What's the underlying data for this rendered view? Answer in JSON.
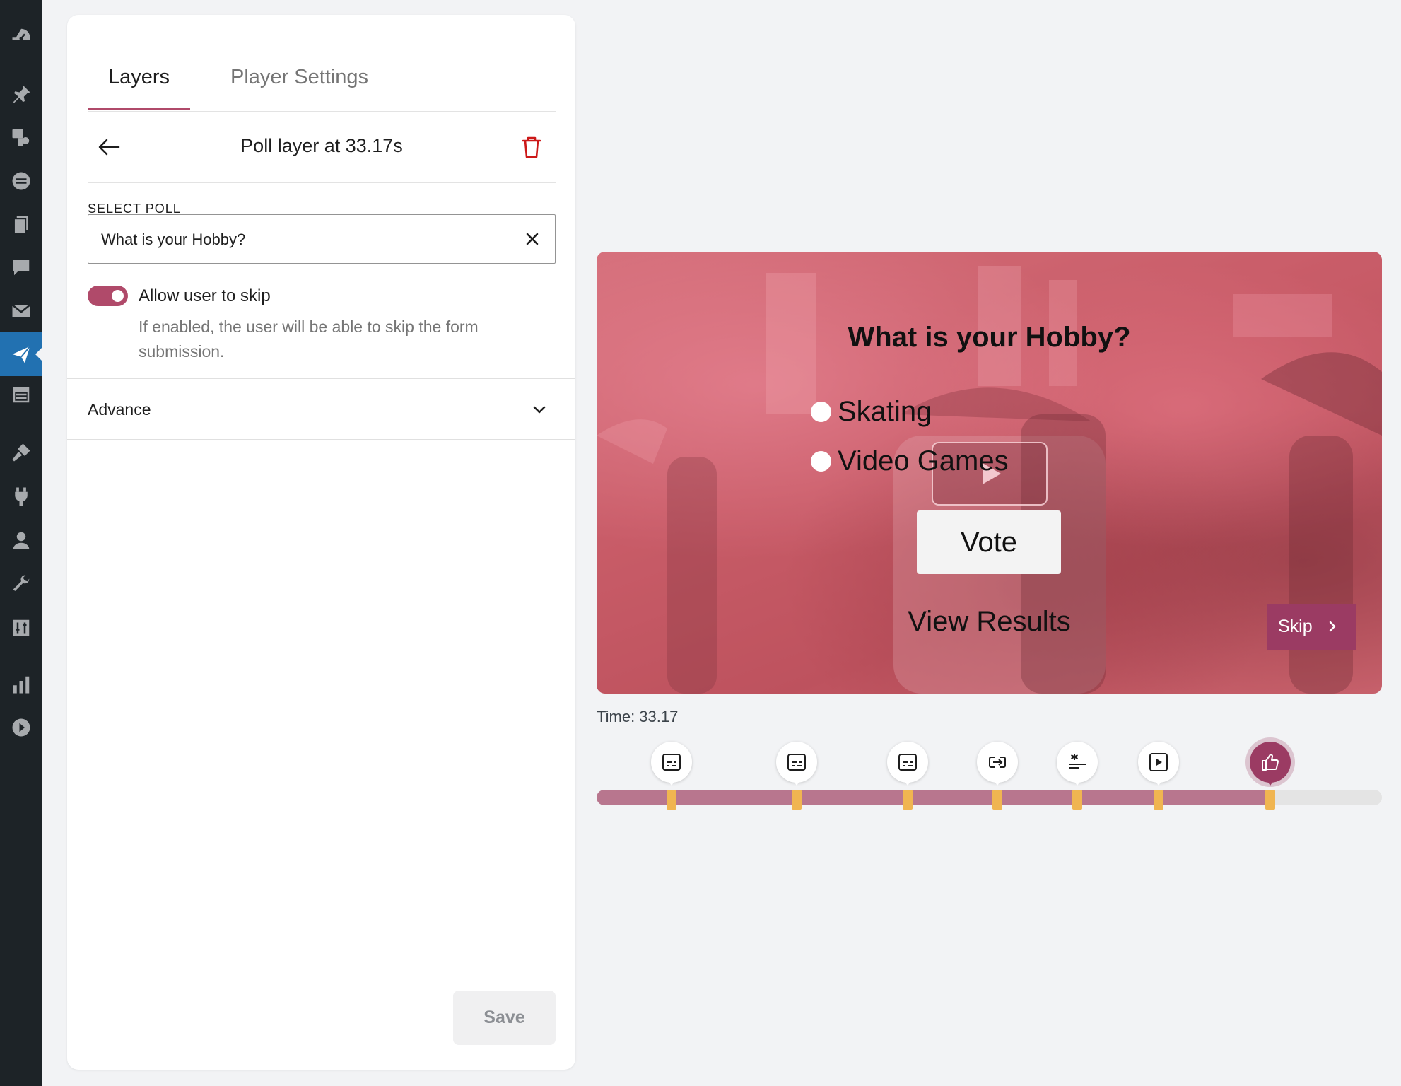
{
  "sidebar": {
    "icons": [
      "dashboard-icon",
      "pin-icon",
      "media-icon",
      "forms-icon",
      "pages-icon",
      "comments-icon",
      "mail-icon",
      "presto-player-icon",
      "calendar-icon",
      "appearance-icon",
      "plugins-icon",
      "users-icon",
      "tools-icon",
      "settings-icon",
      "analytics-icon",
      "play-icon"
    ]
  },
  "panel": {
    "tabs": [
      {
        "label": "Layers",
        "active": true
      },
      {
        "label": "Player Settings",
        "active": false
      }
    ],
    "layer_title": "Poll layer at 33.17s",
    "select_poll": {
      "label": "SELECT POLL",
      "value": "What is your Hobby?"
    },
    "skip_toggle": {
      "label": "Allow user to skip",
      "enabled": true,
      "help": "If enabled, the user will be able to skip the form submission."
    },
    "advance_label": "Advance",
    "save_label": "Save"
  },
  "video": {
    "question": "What is your Hobby?",
    "options": [
      "Skating",
      "Video Games"
    ],
    "vote_label": "Vote",
    "view_results_label": "View Results",
    "skip_label": "Skip"
  },
  "time_label": "Time: 33.17",
  "timeline": {
    "progress": 0.855,
    "markers": [
      {
        "type": "caption-icon",
        "position": 0.095
      },
      {
        "type": "caption-icon",
        "position": 0.255
      },
      {
        "type": "caption-icon",
        "position": 0.396
      },
      {
        "type": "link-icon",
        "position": 0.51
      },
      {
        "type": "sparkle-icon",
        "position": 0.612
      },
      {
        "type": "play-icon",
        "position": 0.716
      },
      {
        "type": "thumbs-up-icon",
        "position": 0.858,
        "active": true
      }
    ]
  },
  "colors": {
    "accent": "#b04a6a",
    "skip_bg": "#9b3b63",
    "wp_sidebar": "#1d2327",
    "wp_active": "#2271b1",
    "marker_tick": "#f0b551"
  }
}
